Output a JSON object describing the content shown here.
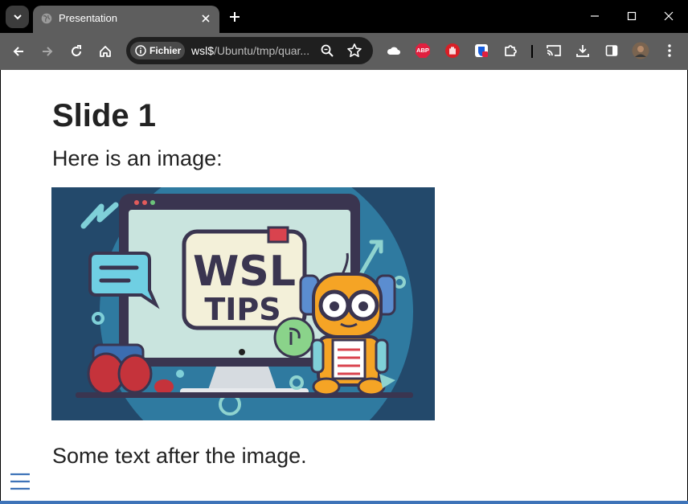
{
  "browser": {
    "tab_title": "Presentation",
    "security_chip_label": "Fichier",
    "url_host": "wsl$",
    "url_path": "/Ubuntu/tmp/quar..."
  },
  "slide": {
    "title": "Slide 1",
    "intro_text": "Here is an image:",
    "image": {
      "sign_line1": "WSL",
      "sign_line2": "TIPS"
    },
    "after_text": "Some text after the image."
  },
  "extensions": {
    "abp_label": "ABP"
  },
  "colors": {
    "accent": "#3e73b8",
    "tab_bg": "#5e5e5e",
    "toolbar_bg": "#5e5e5e"
  }
}
